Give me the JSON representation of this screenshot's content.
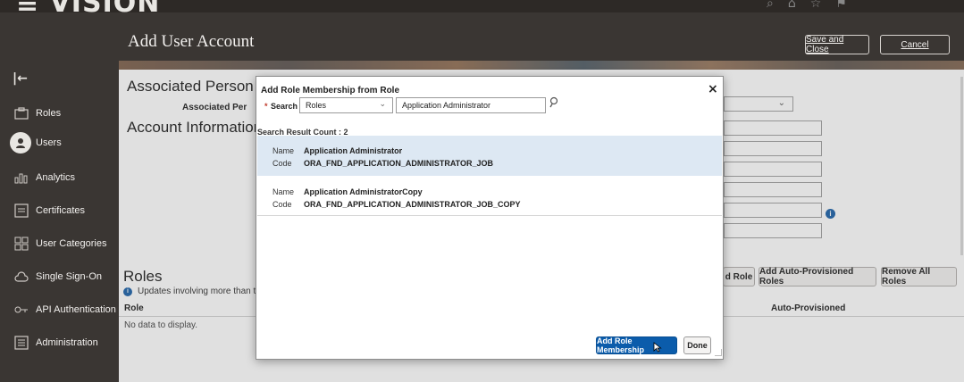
{
  "brand": {
    "name": "VISION"
  },
  "sidebar": {
    "items": [
      {
        "label": "Roles",
        "icon": "roles-icon"
      },
      {
        "label": "Users",
        "icon": "user-icon",
        "active": true
      },
      {
        "label": "Analytics",
        "icon": "analytics-icon"
      },
      {
        "label": "Certificates",
        "icon": "certificate-icon"
      },
      {
        "label": "User Categories",
        "icon": "categories-icon"
      },
      {
        "label": "Single Sign-On",
        "icon": "cloud-icon"
      },
      {
        "label": "API Authentication",
        "icon": "key-icon"
      },
      {
        "label": "Administration",
        "icon": "admin-icon"
      }
    ]
  },
  "header": {
    "title": "Add User Account",
    "save_close_label": "Save and Close",
    "cancel_label": "Cancel"
  },
  "form": {
    "associated_person_title": "Associated Person Ir",
    "associated_person_label": "Associated Per",
    "account_info_title": "Account Information"
  },
  "roles": {
    "title": "Roles",
    "notice": "Updates involving more than tw",
    "add_role_label": "d Role",
    "add_auto_label": "Add Auto-Provisioned Roles",
    "remove_all_label": "Remove All Roles",
    "col_role": "Role",
    "col_auto": "Auto-Provisioned",
    "empty_text": "No data to display."
  },
  "dialog": {
    "title": "Add Role Membership from Role",
    "required_mark": "*",
    "search_label": "Search",
    "search_type": "Roles",
    "search_value": "Application Administrator",
    "result_count": "Search Result Count : 2",
    "results": [
      {
        "name_key": "Name",
        "name": "Application Administrator",
        "code_key": "Code",
        "code": "ORA_FND_APPLICATION_ADMINISTRATOR_JOB",
        "selected": true
      },
      {
        "name_key": "Name",
        "name": "Application AdministratorCopy",
        "code_key": "Code",
        "code": "ORA_FND_APPLICATION_ADMINISTRATOR_JOB_COPY",
        "selected": false
      }
    ],
    "add_button_label": "Add Role Membership",
    "done_label": "Done"
  },
  "colors": {
    "primary_button": "#0b5cab",
    "selected_row": "#dde8f3",
    "shell": "#3a3633"
  }
}
